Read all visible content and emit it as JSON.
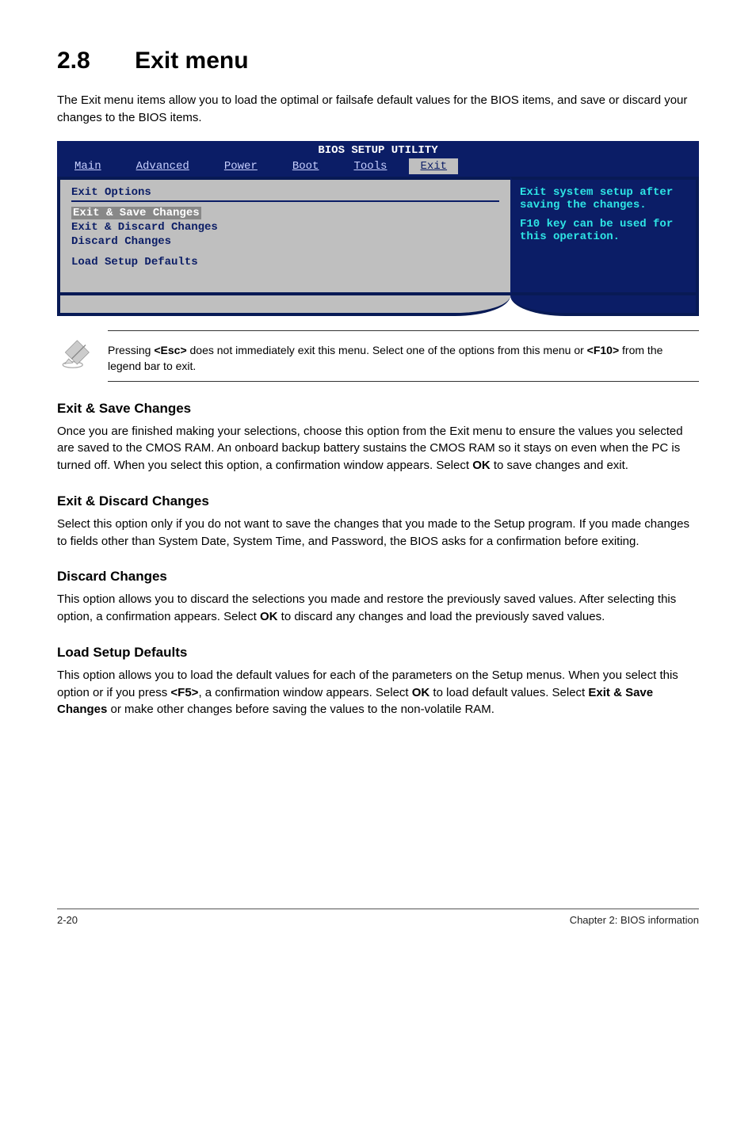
{
  "section": {
    "number": "2.8",
    "title": "Exit menu"
  },
  "intro": "The Exit menu items allow you to load the optimal or failsafe default values for the BIOS items, and save or discard your changes to the BIOS items.",
  "bios": {
    "banner": "BIOS SETUP UTILITY",
    "tabs": [
      "Main",
      "Advanced",
      "Power",
      "Boot",
      "Tools",
      "Exit"
    ],
    "active_tab_index": 5,
    "left_title": "Exit Options",
    "items": [
      {
        "label": "Exit & Save Changes",
        "selected": true
      },
      {
        "label": "Exit & Discard Changes",
        "selected": false
      },
      {
        "label": "Discard Changes",
        "selected": false
      },
      {
        "label": "Load Setup Defaults",
        "selected": false
      }
    ],
    "help": {
      "line1": "Exit system setup after saving the changes.",
      "line2": "F10 key can be used for this operation."
    }
  },
  "note": {
    "text_a": "Pressing ",
    "key1": "<Esc>",
    "text_b": " does not immediately exit this menu. Select one of the options from this menu or ",
    "key2": "<F10>",
    "text_c": " from the legend bar to exit."
  },
  "subs": [
    {
      "title": "Exit & Save Changes",
      "body_parts": [
        "Once you are finished making your selections, choose this option from the Exit menu to ensure the values you selected are saved to the CMOS RAM. An onboard backup battery sustains the CMOS RAM so it stays on even when the PC is turned off. When you select this option, a confirmation window appears. Select ",
        "OK",
        " to save changes and exit."
      ]
    },
    {
      "title": "Exit & Discard Changes",
      "body_parts": [
        "Select this option only if you do not want to save the changes that you made to the Setup program. If you made changes to fields other than System Date, System Time, and Password, the BIOS asks for a confirmation before exiting."
      ]
    },
    {
      "title": "Discard Changes",
      "body_parts": [
        "This option allows you to discard the selections you made and restore the previously saved values. After selecting this option, a confirmation appears. Select ",
        "OK",
        " to discard any changes and load the previously saved values."
      ]
    },
    {
      "title": "Load Setup Defaults",
      "body_parts": [
        "This option allows you to load the default values for each of the parameters on the Setup menus. When you select this option or if you press ",
        "<F5>",
        ", a confirmation window appears. Select ",
        "OK",
        " to load default values. Select ",
        "Exit & Save Changes",
        " or make other changes before saving the values to the non-volatile RAM."
      ]
    }
  ],
  "footer": {
    "left": "2-20",
    "right": "Chapter 2: BIOS information"
  }
}
